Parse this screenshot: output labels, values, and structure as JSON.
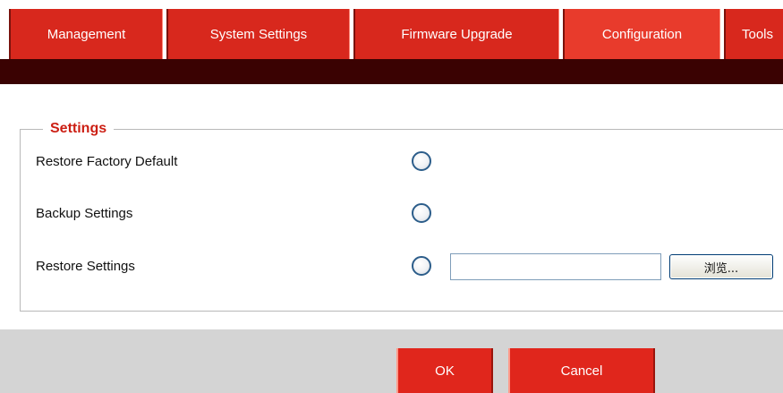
{
  "tabs": [
    {
      "label": "Management",
      "active": false
    },
    {
      "label": "System Settings",
      "active": false
    },
    {
      "label": "Firmware Upgrade",
      "active": false
    },
    {
      "label": "Configuration",
      "active": true
    },
    {
      "label": "Tools",
      "active": false
    }
  ],
  "settings": {
    "legend": "Settings",
    "rows": [
      {
        "label": "Restore Factory Default"
      },
      {
        "label": "Backup Settings"
      },
      {
        "label": "Restore Settings"
      }
    ],
    "file_input": {
      "value": "",
      "placeholder": ""
    },
    "browse_label": "浏览..."
  },
  "footer": {
    "ok_label": "OK",
    "cancel_label": "Cancel"
  },
  "colors": {
    "tab_red": "#d8281d",
    "dark_bar": "#3a0202",
    "legend_red": "#cc1f14",
    "footer_gray": "#d4d4d4"
  }
}
